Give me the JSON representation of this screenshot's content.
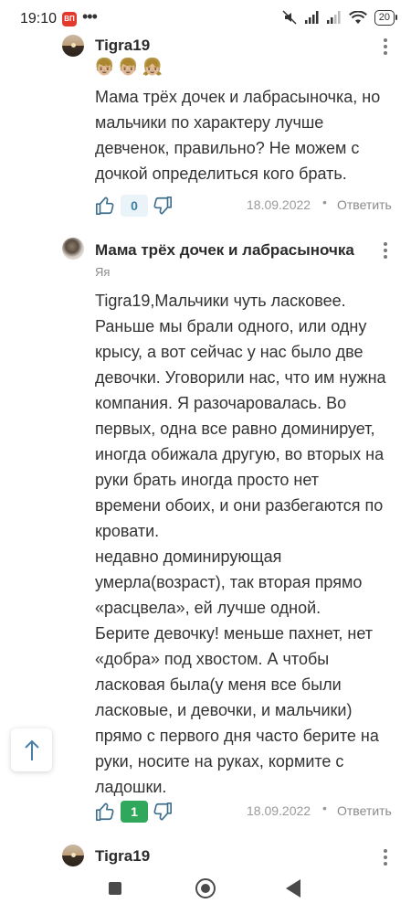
{
  "status_bar": {
    "time": "19:10",
    "notification_badge": "ВП",
    "more": "•••",
    "battery": "20"
  },
  "comments": [
    {
      "author": "Tigra19",
      "emojis": "👦🏼👦🏼👧🏼",
      "text": "Мама трёх дочек и лабрасыночка, но мальчики по характеру лучше девченок, правильно? Не можем с дочкой определиться кого брать.",
      "likes": "0",
      "date": "18.09.2022",
      "separator": "•",
      "reply_label": "Ответить"
    },
    {
      "author": "Мама трёх дочек и лабрасыночка",
      "subtitle": "Яя",
      "text": "Tigra19,Мальчики чуть ласковее.\nРаньше мы брали одного, или одну\nкрысу, а вот сейчас у нас было две\nдевочки. Уговорили нас, что им нужна\nкомпания. Я разочаровалась. Во\nпервых, одна все равно доминирует,\nиногда обижала другую, во вторых на\nруки брать иногда просто нет\nвремени обоих, и они разбегаются по\nкровати.\nнедавно доминирующая\nумерла(возраст), так вторая прямо\n«расцвела», ей лучше одной.\nБерите девочку! меньше пахнет, нет\n«добра» под хвостом. А чтобы\nласковая была(у меня все были\nласковые, и девочки, и мальчики)\nпрямо с первого дня часто берите на\nруки, носите на руках, кормите с\nладошки.",
      "likes": "1",
      "date": "18.09.2022",
      "separator": "•",
      "reply_label": "Ответить"
    },
    {
      "author": "Tigra19"
    }
  ],
  "colors": {
    "like_zero_bg": "#eaf3f8",
    "like_positive_bg": "#2fa85b"
  },
  "icons": [
    "thumb-up-icon",
    "thumb-down-icon",
    "kebab-menu-icon",
    "arrow-up-icon",
    "wifi-icon",
    "signal-icon",
    "mute-icon"
  ]
}
